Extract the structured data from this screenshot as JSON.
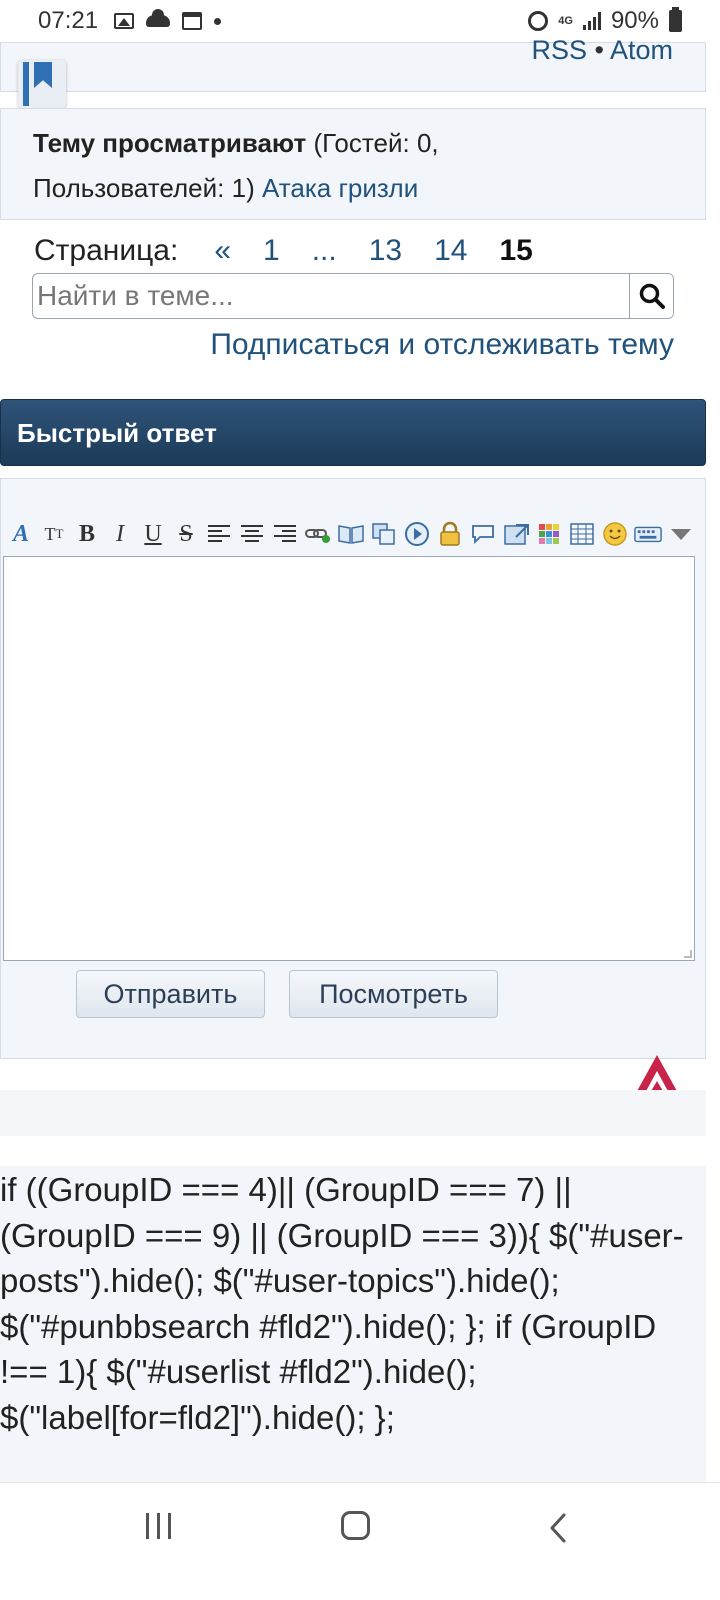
{
  "status_bar": {
    "time": "07:21",
    "network": "4G",
    "battery": "90%"
  },
  "feeds": {
    "rss": "RSS",
    "separator": "•",
    "atom": "Atom"
  },
  "viewers": {
    "title": "Тему просматривают",
    "counts": "(Гостей: 0,",
    "users_prefix": "Пользователей: 1)",
    "user": "Атака гризли"
  },
  "pagination": {
    "label": "Страница:",
    "prev": "«",
    "pages": [
      "1",
      "...",
      "13",
      "14"
    ],
    "current": "15"
  },
  "search": {
    "placeholder": "Найти в теме..."
  },
  "subscribe_link": "Подписаться и отслеживать тему",
  "quick_reply": {
    "title": "Быстрый ответ",
    "toolbar": [
      "font-icon",
      "font-size-icon",
      "bold-icon",
      "italic-icon",
      "underline-icon",
      "strikethrough-icon",
      "align-left-icon",
      "align-center-icon",
      "align-right-icon",
      "link-icon",
      "book-icon",
      "copy-icon",
      "media-icon",
      "lock-icon",
      "speech-bubble-icon",
      "image-icon",
      "color-icon",
      "table-icon",
      "smiley-icon",
      "keyboard-icon",
      "more-icon"
    ],
    "send_button": "Отправить",
    "preview_button": "Посмотреть"
  },
  "script_text": "if ((GroupID === 4)|| (GroupID === 7) || (GroupID === 9) || (GroupID === 3)){ $(\"#user-posts\").hide(); $(\"#user-topics\").hide(); $(\"#punbbsearch #fld2\").hide(); }; if (GroupID !== 1){ $(\"#userlist #fld2\").hide(); $(\"label[for=fld2]\").hide(); };",
  "colors": {
    "link": "#21527b",
    "header_bg": "#1c3a58",
    "panel_bg": "#f2f5f9",
    "up_arrow": "#c8244a"
  }
}
